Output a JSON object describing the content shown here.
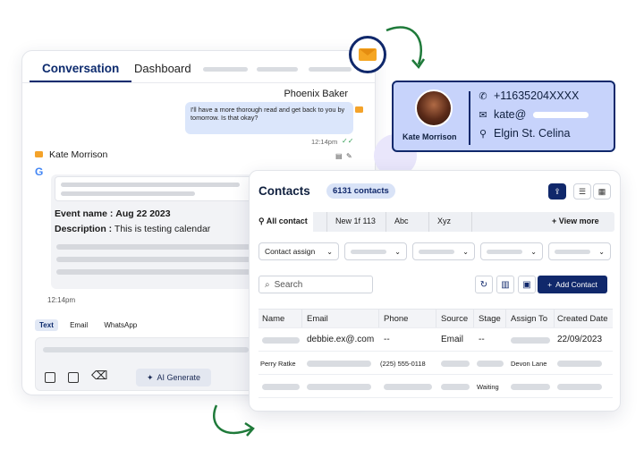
{
  "conversation": {
    "tabs": [
      "Conversation",
      "Dashboard"
    ],
    "sender": "Phoenix Baker",
    "bubble_text": "I'll have a more thorough read and get back to you by tomorrow. Is that okay?",
    "bubble_time": "12:14pm",
    "contact_name": "Kate Morrison",
    "event_name_label": "Event name :",
    "event_name_value": "Aug 22 2023",
    "description_label": "Description :",
    "description_value": "This is testing calendar",
    "event_time": "12:14pm",
    "message_tabs": [
      "Text",
      "Email",
      "WhatsApp"
    ],
    "ai_button": "AI Generate"
  },
  "contact_card": {
    "name": "Kate Morrison",
    "phone": "+11635204XXXX",
    "email_prefix": "kate@",
    "address": "Elgin St. Celina"
  },
  "contacts": {
    "title": "Contacts",
    "count_badge": "6131 contacts",
    "tabs": [
      "All contact",
      "New 1f 113",
      "Abc",
      "Xyz"
    ],
    "view_more": "View more",
    "filter_label": "Contact assign",
    "search_placeholder": "Search",
    "add_button": "Add Contact",
    "columns": [
      "Name",
      "Email",
      "Phone",
      "Source",
      "Stage",
      "Assign To",
      "Created Date"
    ],
    "rows": [
      {
        "email": "debbie.ex@.com",
        "phone": "--",
        "source": "Email",
        "stage": "--",
        "date": "22/09/2023"
      },
      {
        "name": "Perry Ratke",
        "phone": "(225) 555-0118",
        "assign": "Devon Lane"
      },
      {
        "stage": "Waiting"
      }
    ]
  },
  "colors": {
    "navy": "#10286b",
    "card_bg": "#c7d3fb",
    "accent_orange": "#f5a623",
    "arrow_green": "#1f7a3a"
  },
  "icons": [
    "mail-icon",
    "phone-icon",
    "location-icon",
    "google-icon",
    "image-icon",
    "layout-icon",
    "eraser-icon",
    "sparkle-icon",
    "pin-icon",
    "plus-icon",
    "search-icon",
    "refresh-icon",
    "columns-icon",
    "save-icon",
    "list-icon",
    "grid-icon",
    "upload-icon"
  ]
}
